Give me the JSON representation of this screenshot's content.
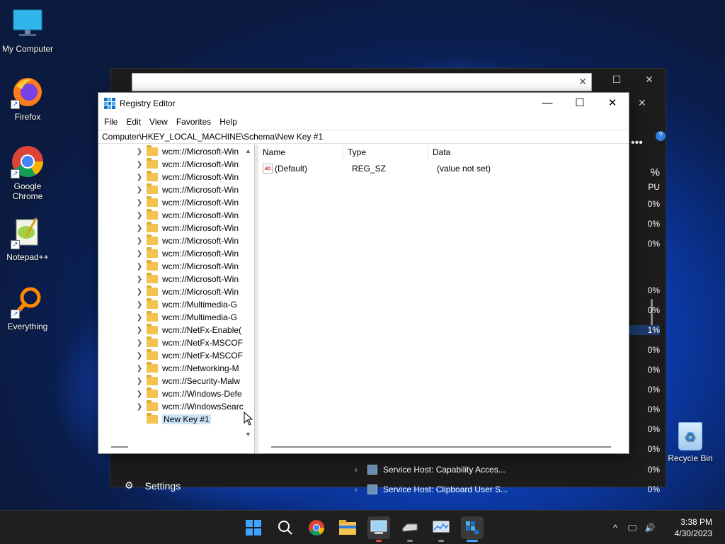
{
  "desktop": {
    "icons": [
      {
        "label": "My Computer",
        "icon": "monitor-icon"
      },
      {
        "label": "Firefox",
        "icon": "firefox-icon"
      },
      {
        "label": "Google Chrome",
        "icon": "chrome-icon"
      },
      {
        "label": "Notepad++",
        "icon": "notepadpp-icon"
      },
      {
        "label": "Everything",
        "icon": "search-magnifier-icon"
      }
    ],
    "recycle_bin": "Recycle Bin"
  },
  "task_manager": {
    "header_pct": "%",
    "header_cpu": "PU",
    "more_menu": "•••",
    "help": "?",
    "settings_label": "Settings",
    "percent_values": [
      "0%",
      "0%",
      "0%",
      "0%",
      "0%",
      "1%",
      "0%",
      "0%",
      "0%",
      "0%",
      "0%",
      "0%",
      "0%",
      "0%"
    ],
    "rows": [
      {
        "name": "Service Host: Capability Acces...",
        "cpu": "0%"
      },
      {
        "name": "Service Host: Clipboard User S...",
        "cpu": "0%"
      }
    ]
  },
  "registry": {
    "title": "Registry Editor",
    "menu": [
      "File",
      "Edit",
      "View",
      "Favorites",
      "Help"
    ],
    "address": "Computer\\HKEY_LOCAL_MACHINE\\Schema\\New Key #1",
    "tree": [
      "wcm://Microsoft-Win",
      "wcm://Microsoft-Win",
      "wcm://Microsoft-Win",
      "wcm://Microsoft-Win",
      "wcm://Microsoft-Win",
      "wcm://Microsoft-Win",
      "wcm://Microsoft-Win",
      "wcm://Microsoft-Win",
      "wcm://Microsoft-Win",
      "wcm://Microsoft-Win",
      "wcm://Microsoft-Win",
      "wcm://Microsoft-Win",
      "wcm://Multimedia-G",
      "wcm://Multimedia-G",
      "wcm://NetFx-Enable(",
      "wcm://NetFx-MSCOF",
      "wcm://NetFx-MSCOF",
      "wcm://Networking-M",
      "wcm://Security-Malw",
      "wcm://Windows-Defe",
      "wcm://WindowsSearc"
    ],
    "selected_key": "New Key #1",
    "columns": {
      "name": "Name",
      "type": "Type",
      "data": "Data"
    },
    "values": [
      {
        "name": "(Default)",
        "type": "REG_SZ",
        "data": "(value not set)"
      }
    ]
  },
  "taskbar": {
    "time": "3:38 PM",
    "date": "4/30/2023"
  }
}
